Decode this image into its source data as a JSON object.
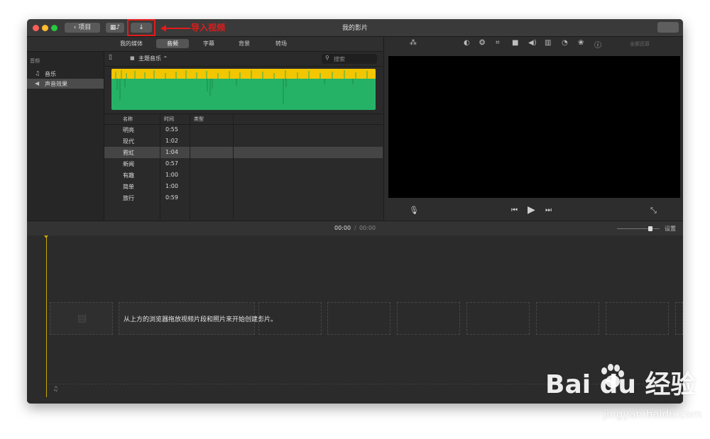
{
  "window": {
    "title": "我的影片",
    "back_button": "项目",
    "import_annotation": "导入视频",
    "colors": {
      "annotation": "#e21b1b",
      "waveform_green": "#25b266",
      "waveform_yellow": "#f2c600",
      "playhead": "#c8a800"
    }
  },
  "tabs": [
    {
      "label": "我的媒体",
      "active": false
    },
    {
      "label": "音频",
      "active": true
    },
    {
      "label": "字幕",
      "active": false
    },
    {
      "label": "背景",
      "active": false
    },
    {
      "label": "转场",
      "active": false
    }
  ],
  "sidebar": {
    "heading": "音频",
    "items": [
      {
        "label": "音乐",
        "icon": "music-disc-icon",
        "glyph": "♫",
        "selected": false
      },
      {
        "label": "声音效果",
        "icon": "speaker-icon",
        "glyph": "◀",
        "selected": true
      }
    ]
  },
  "browser": {
    "folder_label": "主题音乐 ⌃",
    "search_placeholder": "搜索",
    "columns": [
      "名称",
      "时间",
      "类型"
    ],
    "rows": [
      {
        "name": "明亮",
        "time": "0:55",
        "type": ""
      },
      {
        "name": "现代",
        "time": "1:02",
        "type": ""
      },
      {
        "name": "霓虹",
        "time": "1:04",
        "type": "",
        "selected": true
      },
      {
        "name": "新闻",
        "time": "0:57",
        "type": ""
      },
      {
        "name": "有趣",
        "time": "1:00",
        "type": ""
      },
      {
        "name": "简单",
        "time": "1:00",
        "type": ""
      },
      {
        "name": "旅行",
        "time": "0:59",
        "type": ""
      }
    ]
  },
  "viewer": {
    "reset_label": "全部还原"
  },
  "timeline": {
    "current_time": "00:00",
    "separator": "/",
    "total_time": "00:00",
    "settings_label": "设置",
    "zoom_level": 0.6,
    "placeholder_text": "从上方的浏览器拖放视频片段和照片来开始创建影片。"
  },
  "watermark": {
    "brand": "Bai du 经验",
    "url": "jingyan.baidu.com"
  }
}
